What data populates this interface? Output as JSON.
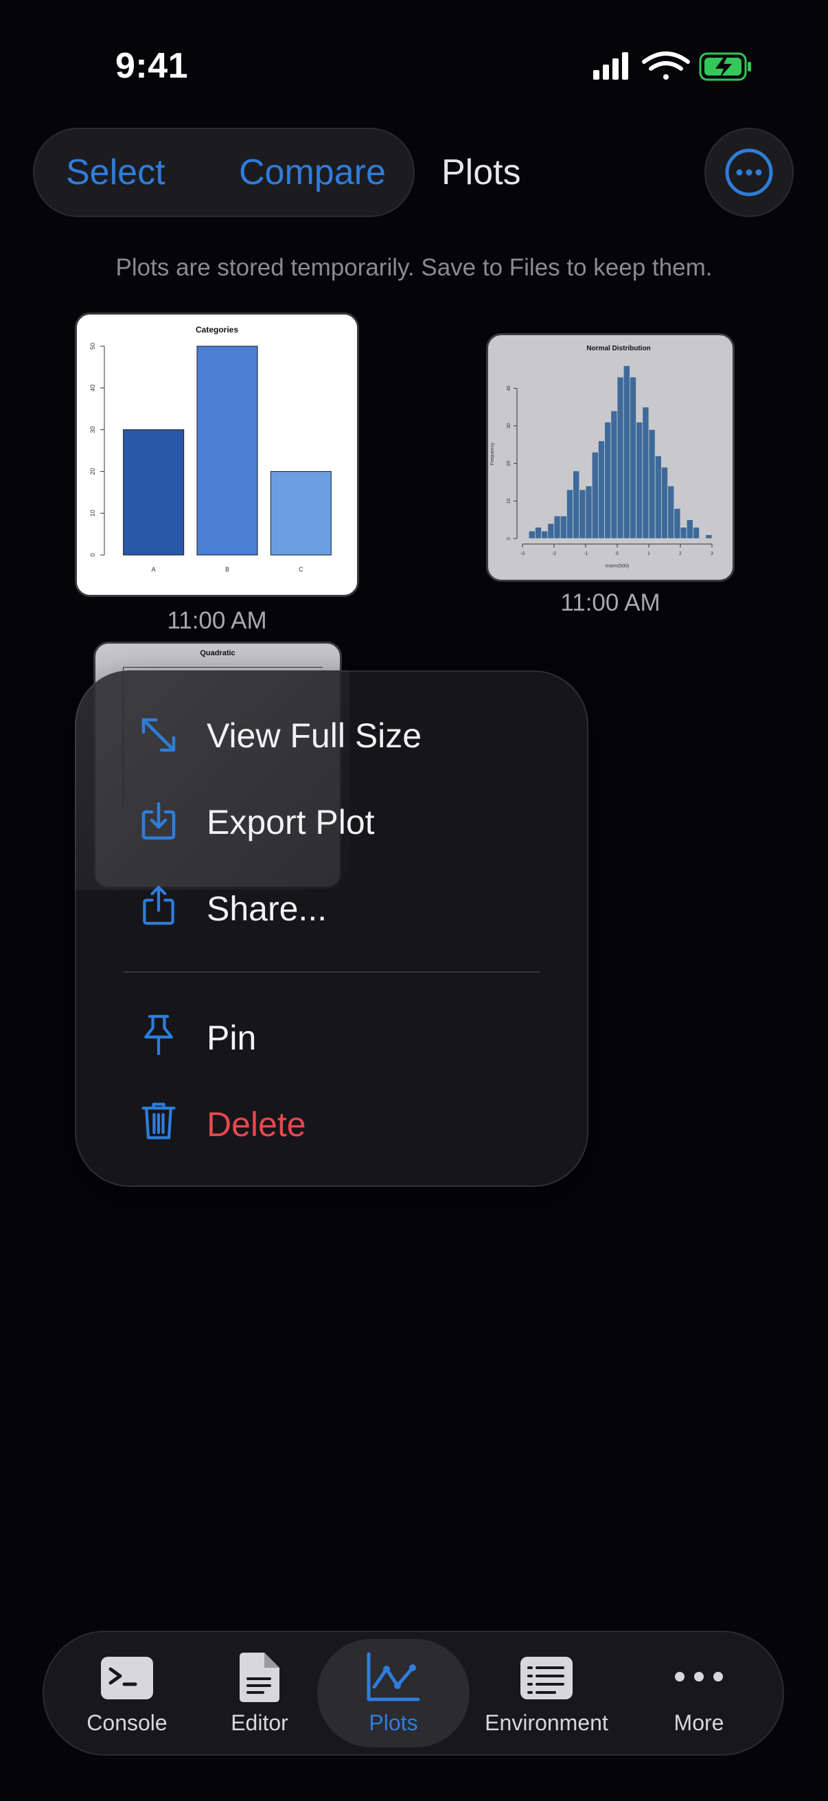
{
  "status": {
    "time": "9:41"
  },
  "toolbar": {
    "select_label": "Select",
    "compare_label": "Compare",
    "title": "Plots"
  },
  "note": "Plots are stored temporarily. Save to Files to keep them.",
  "plots": [
    {
      "title": "Categories",
      "timestamp": "11:00 AM"
    },
    {
      "title": "Normal Distribution",
      "timestamp": "11:00 AM"
    },
    {
      "title": "Quadratic"
    }
  ],
  "chart_data": [
    {
      "type": "bar",
      "title": "Categories",
      "categories": [
        "A",
        "B",
        "C"
      ],
      "values": [
        30,
        50,
        20
      ],
      "ylim": [
        0,
        50
      ],
      "yticks": [
        "0",
        "10",
        "20",
        "30",
        "40",
        "50"
      ],
      "colors": [
        "#2a57a8",
        "#4a7fd4",
        "#6a9fe2"
      ]
    },
    {
      "type": "bar",
      "title": "Normal Distribution",
      "xlabel": "rnorm(500)",
      "ylabel": "Frequency",
      "xlim": [
        -3,
        3
      ],
      "ylim": [
        0,
        45
      ],
      "xticks": [
        "-3",
        "-2",
        "-1",
        "0",
        "1",
        "2",
        "3"
      ],
      "yticks": [
        "0",
        "10",
        "20",
        "30",
        "40"
      ],
      "bin_width": 0.2,
      "bin_start": -3,
      "values": [
        0,
        2,
        3,
        2,
        4,
        6,
        6,
        13,
        18,
        13,
        14,
        23,
        26,
        31,
        34,
        43,
        46,
        43,
        31,
        35,
        29,
        22,
        19,
        14,
        8,
        3,
        5,
        3,
        0,
        1
      ],
      "color": "#3d6a9a"
    }
  ],
  "menu": {
    "items": [
      {
        "label": "View Full Size",
        "icon": "expand-arrows-icon"
      },
      {
        "label": "Export Plot",
        "icon": "export-tray-icon"
      },
      {
        "label": "Share...",
        "icon": "share-icon"
      },
      {
        "label": "Pin",
        "icon": "pin-icon"
      },
      {
        "label": "Delete",
        "icon": "trash-icon"
      }
    ]
  },
  "tabs": [
    {
      "label": "Console",
      "icon": "terminal-icon"
    },
    {
      "label": "Editor",
      "icon": "document-icon"
    },
    {
      "label": "Plots",
      "icon": "line-chart-icon",
      "active": true
    },
    {
      "label": "Environment",
      "icon": "list-icon"
    },
    {
      "label": "More",
      "icon": "ellipsis-icon"
    }
  ],
  "colors": {
    "accent": "#2f7ddb",
    "destructive": "#e5484d",
    "battery": "#34c759"
  }
}
